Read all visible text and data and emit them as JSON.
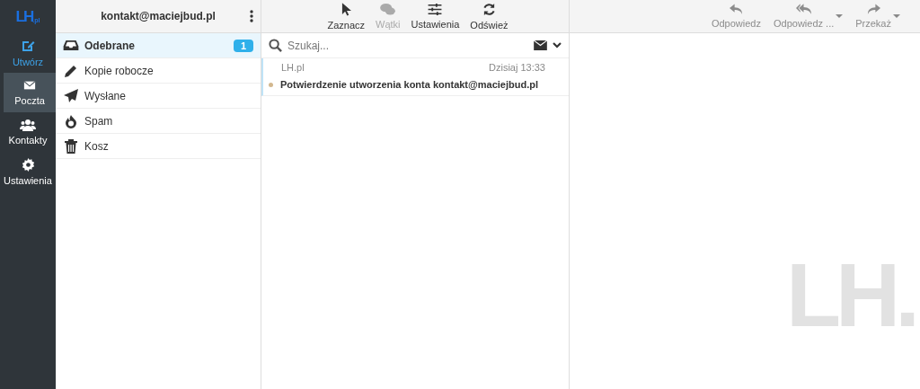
{
  "logo": {
    "main": "LH",
    "suffix": ".pl"
  },
  "nav": [
    {
      "label": "Utwórz",
      "kind": "compose",
      "selected": false
    },
    {
      "label": "Poczta",
      "kind": "nav",
      "selected": true
    },
    {
      "label": "Kontakty",
      "kind": "nav",
      "selected": false
    },
    {
      "label": "Ustawienia",
      "kind": "nav",
      "selected": false
    }
  ],
  "account": "kontakt@maciejbud.pl",
  "folders": [
    {
      "label": "Odebrane",
      "selected": true,
      "count": "1"
    },
    {
      "label": "Kopie robocze",
      "selected": false
    },
    {
      "label": "Wysłane",
      "selected": false
    },
    {
      "label": "Spam",
      "selected": false
    },
    {
      "label": "Kosz",
      "selected": false
    }
  ],
  "list_toolbar": [
    {
      "label": "Zaznacz",
      "disabled": false
    },
    {
      "label": "Wątki",
      "disabled": true
    },
    {
      "label": "Ustawienia",
      "disabled": false
    },
    {
      "label": "Odśwież",
      "disabled": false
    }
  ],
  "search": {
    "placeholder": "Szukaj..."
  },
  "messages": [
    {
      "from": "LH.pl",
      "date": "Dzisiaj 13:33",
      "subject": "Potwierdzenie utworzenia konta kontakt@maciejbud.pl",
      "unread": true
    }
  ],
  "preview_toolbar": [
    {
      "label": "Odpowiedz",
      "disabled": true,
      "has_menu": false
    },
    {
      "label": "Odpowiedz ...",
      "disabled": true,
      "has_menu": true
    },
    {
      "label": "Przekaż",
      "disabled": true,
      "has_menu": true
    }
  ],
  "preview_logo": {
    "main": "LH",
    "dot": "."
  }
}
